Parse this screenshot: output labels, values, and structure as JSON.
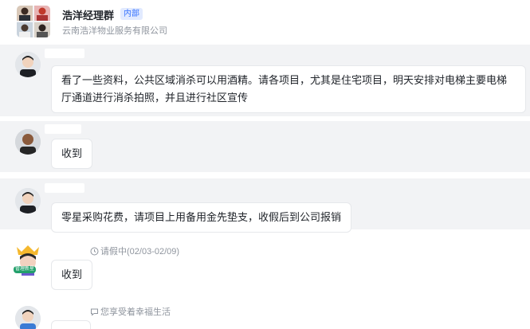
{
  "header": {
    "title": "浩洋经理群",
    "tag": "内部",
    "subtitle": "云南浩洋物业服务有限公司"
  },
  "messages": [
    {
      "text": "看了一些资料，公共区域消杀可以用酒精。请各项目，尤其是住宅项目，明天安排对电梯主要电梯厅通道进行消杀拍照，并且进行社区宣传"
    },
    {
      "text": "收到"
    },
    {
      "text": "零星采购花费，请项目上用备用金先垫支，收假后到公司报销"
    },
    {
      "status": "请假中(02/03-02/09)",
      "badge": "管理新星",
      "text": "收到"
    },
    {
      "status": "您享受着幸福生活"
    }
  ],
  "colors": {
    "accent": "#3370ff",
    "highlight": "#f2f3f5",
    "status_text": "#8f959e"
  }
}
